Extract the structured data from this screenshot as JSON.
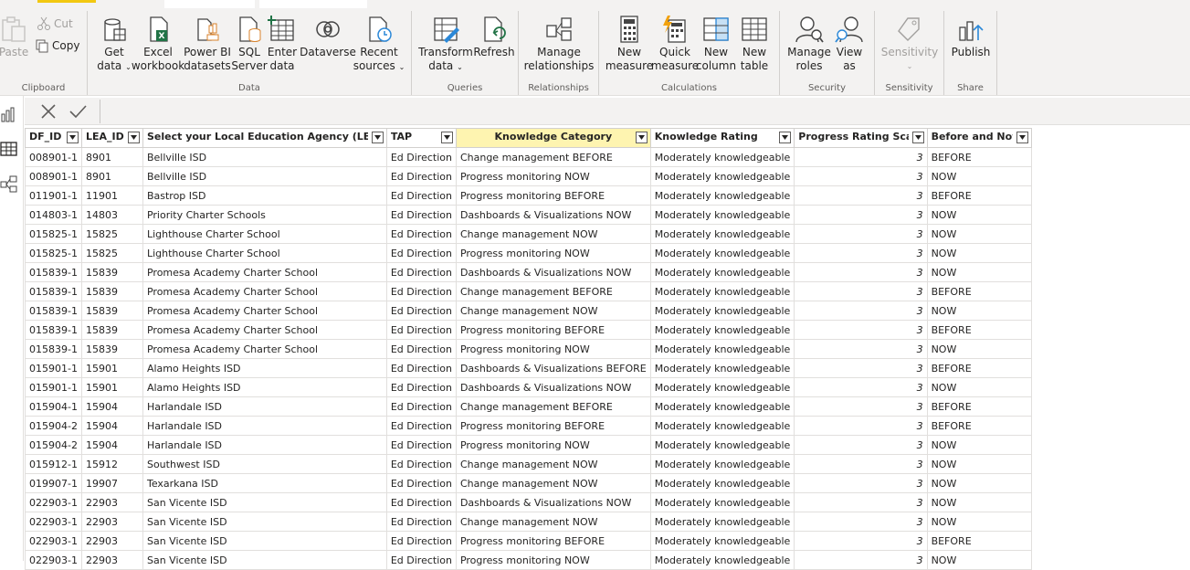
{
  "ribbon": {
    "colors": {
      "accent": "#f2c811",
      "background": "#f3f2f1"
    },
    "clipboard": {
      "label": "Clipboard",
      "paste": "Paste",
      "cut": "Cut",
      "copy": "Copy"
    },
    "data": {
      "label": "Data",
      "get_data_1": "Get",
      "get_data_2": "data",
      "excel_1": "Excel",
      "excel_2": "workbook",
      "powerbi_1": "Power BI",
      "powerbi_2": "datasets",
      "sql_1": "SQL",
      "sql_2": "Server",
      "enter_1": "Enter",
      "enter_2": "data",
      "dataverse": "Dataverse",
      "recent_1": "Recent",
      "recent_2": "sources"
    },
    "queries": {
      "label": "Queries",
      "transform_1": "Transform",
      "transform_2": "data",
      "refresh": "Refresh"
    },
    "relationships": {
      "label": "Relationships",
      "manage_1": "Manage",
      "manage_2": "relationships"
    },
    "calculations": {
      "label": "Calculations",
      "new_measure_1": "New",
      "new_measure_2": "measure",
      "quick_measure_1": "Quick",
      "quick_measure_2": "measure",
      "new_column_1": "New",
      "new_column_2": "column",
      "new_table_1": "New",
      "new_table_2": "table"
    },
    "security": {
      "label": "Security",
      "manage_roles_1": "Manage",
      "manage_roles_2": "roles",
      "view_as_1": "View",
      "view_as_2": "as"
    },
    "sensitivity": {
      "label": "Sensitivity",
      "button": "Sensitivity"
    },
    "share": {
      "label": "Share",
      "publish": "Publish"
    }
  },
  "table": {
    "columns": [
      "DF_ID",
      "LEA_ID",
      "Select your Local Education Agency (LEA)",
      "TAP",
      "Knowledge Category",
      "Knowledge Rating",
      "Progress Rating Scale",
      "Before  and Now"
    ],
    "rows": [
      [
        "008901-1",
        "8901",
        "Bellville ISD",
        "Ed Direction",
        "Change management BEFORE",
        "Moderately knowledgeable",
        "3",
        "BEFORE"
      ],
      [
        "008901-1",
        "8901",
        "Bellville ISD",
        "Ed Direction",
        "Progress monitoring NOW",
        "Moderately knowledgeable",
        "3",
        "NOW"
      ],
      [
        "011901-1",
        "11901",
        "Bastrop ISD",
        "Ed Direction",
        "Progress monitoring BEFORE",
        "Moderately knowledgeable",
        "3",
        "BEFORE"
      ],
      [
        "014803-1",
        "14803",
        "Priority Charter Schools",
        "Ed Direction",
        "Dashboards & Visualizations NOW",
        "Moderately knowledgeable",
        "3",
        "NOW"
      ],
      [
        "015825-1",
        "15825",
        "Lighthouse Charter School",
        "Ed Direction",
        "Change management NOW",
        "Moderately knowledgeable",
        "3",
        "NOW"
      ],
      [
        "015825-1",
        "15825",
        "Lighthouse Charter School",
        "Ed Direction",
        "Progress monitoring NOW",
        "Moderately knowledgeable",
        "3",
        "NOW"
      ],
      [
        "015839-1",
        "15839",
        "Promesa Academy Charter School",
        "Ed Direction",
        "Dashboards & Visualizations NOW",
        "Moderately knowledgeable",
        "3",
        "NOW"
      ],
      [
        "015839-1",
        "15839",
        "Promesa Academy Charter School",
        "Ed Direction",
        "Change management BEFORE",
        "Moderately knowledgeable",
        "3",
        "BEFORE"
      ],
      [
        "015839-1",
        "15839",
        "Promesa Academy Charter School",
        "Ed Direction",
        "Change management NOW",
        "Moderately knowledgeable",
        "3",
        "NOW"
      ],
      [
        "015839-1",
        "15839",
        "Promesa Academy Charter School",
        "Ed Direction",
        "Progress monitoring BEFORE",
        "Moderately knowledgeable",
        "3",
        "BEFORE"
      ],
      [
        "015839-1",
        "15839",
        "Promesa Academy Charter School",
        "Ed Direction",
        "Progress monitoring NOW",
        "Moderately knowledgeable",
        "3",
        "NOW"
      ],
      [
        "015901-1",
        "15901",
        "Alamo Heights ISD",
        "Ed Direction",
        "Dashboards & Visualizations BEFORE",
        "Moderately knowledgeable",
        "3",
        "BEFORE"
      ],
      [
        "015901-1",
        "15901",
        "Alamo Heights ISD",
        "Ed Direction",
        "Dashboards & Visualizations NOW",
        "Moderately knowledgeable",
        "3",
        "NOW"
      ],
      [
        "015904-1",
        "15904",
        "Harlandale ISD",
        "Ed Direction",
        "Change management BEFORE",
        "Moderately knowledgeable",
        "3",
        "BEFORE"
      ],
      [
        "015904-2",
        "15904",
        "Harlandale ISD",
        "Ed Direction",
        "Progress monitoring BEFORE",
        "Moderately knowledgeable",
        "3",
        "BEFORE"
      ],
      [
        "015904-2",
        "15904",
        "Harlandale ISD",
        "Ed Direction",
        "Progress monitoring NOW",
        "Moderately knowledgeable",
        "3",
        "NOW"
      ],
      [
        "015912-1",
        "15912",
        "Southwest ISD",
        "Ed Direction",
        "Change management NOW",
        "Moderately knowledgeable",
        "3",
        "NOW"
      ],
      [
        "019907-1",
        "19907",
        "Texarkana ISD",
        "Ed Direction",
        "Change management NOW",
        "Moderately knowledgeable",
        "3",
        "NOW"
      ],
      [
        "022903-1",
        "22903",
        "San Vicente ISD",
        "Ed Direction",
        "Dashboards & Visualizations NOW",
        "Moderately knowledgeable",
        "3",
        "NOW"
      ],
      [
        "022903-1",
        "22903",
        "San Vicente ISD",
        "Ed Direction",
        "Change management NOW",
        "Moderately knowledgeable",
        "3",
        "NOW"
      ],
      [
        "022903-1",
        "22903",
        "San Vicente ISD",
        "Ed Direction",
        "Progress monitoring BEFORE",
        "Moderately knowledgeable",
        "3",
        "BEFORE"
      ],
      [
        "022903-1",
        "22903",
        "San Vicente ISD",
        "Ed Direction",
        "Progress monitoring NOW",
        "Moderately knowledgeable",
        "3",
        "NOW"
      ]
    ]
  }
}
